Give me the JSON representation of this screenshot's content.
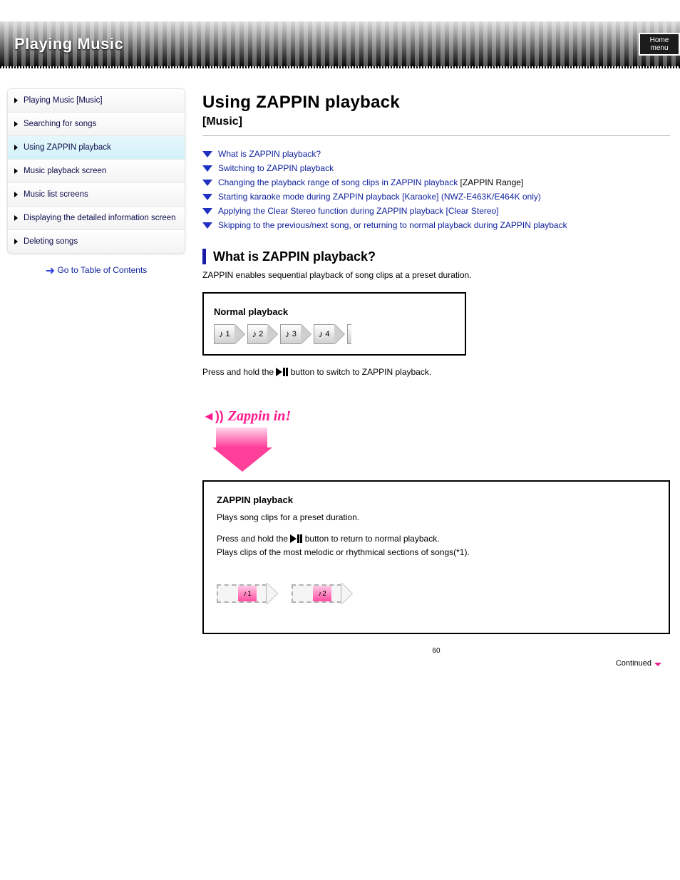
{
  "banner": {
    "title": "Playing Music",
    "tab": "Home menu"
  },
  "sidebar": {
    "items": [
      {
        "label": "Playing Music [Music]"
      },
      {
        "label": "Searching for songs"
      },
      {
        "label": "Using ZAPPIN playback"
      },
      {
        "label": "Music playback screen"
      },
      {
        "label": "Music list screens"
      },
      {
        "label": "Displaying the detailed information screen"
      },
      {
        "label": "Deleting songs"
      }
    ],
    "toc": "Go to Table of Contents"
  },
  "page": {
    "title": "Using ZAPPIN playback",
    "subtitle": "[Music]"
  },
  "linklist": [
    {
      "text": "What is ZAPPIN playback?"
    },
    {
      "text": "Switching to ZAPPIN playback"
    },
    {
      "text": "Changing the playback range of song clips in ZAPPIN playback",
      "extra": "[ZAPPIN Range]"
    },
    {
      "text": "Starting karaoke mode during ZAPPIN playback [Karaoke] (NWZ-E463K/E464K only)"
    },
    {
      "text": "Applying the Clear Stereo function during ZAPPIN playback [Clear Stereo]"
    },
    {
      "text": "Skipping to the previous/next song, or returning to normal playback during ZAPPIN playback"
    }
  ],
  "section": {
    "heading": "What is ZAPPIN playback?",
    "body": "ZAPPIN enables sequential playback of song clips at a preset duration."
  },
  "normalbox": {
    "title": "Normal playback",
    "songs": [
      "1",
      "2",
      "3",
      "4"
    ],
    "after_prefix": "Press and hold the ",
    "after_suffix": " button to switch to ZAPPIN playback."
  },
  "zap": {
    "speaker_icon": "sound-icon",
    "label": "Zappin in!"
  },
  "zapbox": {
    "title": "ZAPPIN playback",
    "sub": "Plays song clips for a preset duration.",
    "line1a": "Press and hold the ",
    "line1b": " button to return to normal playback.",
    "line2": "Plays clips of the most melodic or rhythmical sections of songs(*1).",
    "songs": [
      "1",
      "2"
    ]
  },
  "pageno": "60",
  "cont": "Continued"
}
